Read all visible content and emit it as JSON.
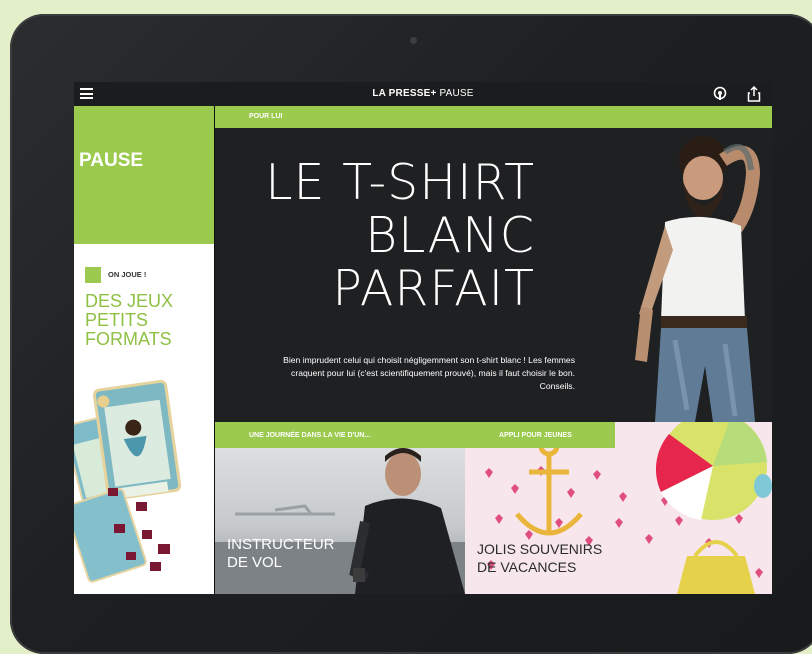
{
  "topbar": {
    "brand": "LA PRESSE",
    "brand_plus": "+",
    "brand_section": "PAUSE"
  },
  "left": {
    "section_title": "PAUSE",
    "kicker": "ON JOUE !",
    "title_lines": [
      "DES JEUX",
      "PETITS",
      "FORMATS"
    ]
  },
  "hero": {
    "category": "POUR LUI",
    "title_lines": [
      "LE T-SHIRT",
      "BLANC",
      "PARFAIT"
    ],
    "text": "Bien imprudent celui qui choisit négligemment son t-shirt blanc ! Les femmes craquent pour lui (c'est scientifiquement prouvé), mais il faut choisir le bon. Conseils."
  },
  "tile1": {
    "category": "UNE JOURNÉE DANS LA VIE D'UN...",
    "title_lines": [
      "INSTRUCTEUR",
      "DE VOL"
    ]
  },
  "tile2": {
    "category": "APPLI POUR JEUNES",
    "title_lines": [
      "JOLIS SOUVENIRS",
      "DE VACANCES"
    ]
  },
  "colors": {
    "accent_green": "#9cca4f",
    "title_green": "#8fc043",
    "background": "#e3efc9"
  },
  "icons": [
    "menu-icon",
    "podcast-icon",
    "share-icon"
  ]
}
